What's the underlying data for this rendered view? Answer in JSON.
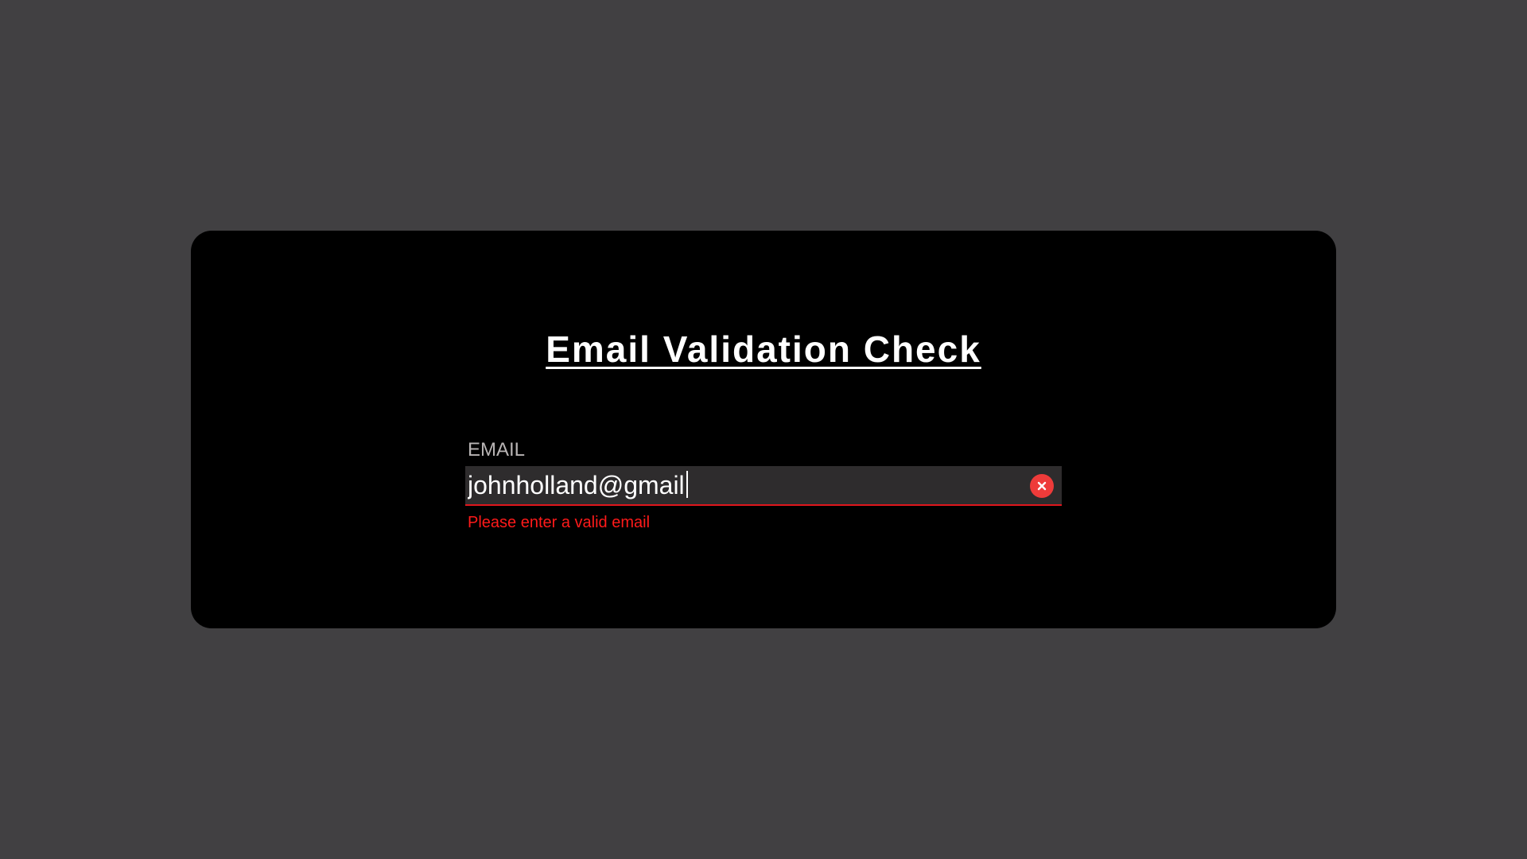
{
  "page": {
    "title": "Email Validation Check"
  },
  "email_field": {
    "label": "EMAIL",
    "value": "johnholland@gmail",
    "error_message": "Please enter a valid email",
    "clear_icon": "close-circle-icon"
  },
  "colors": {
    "page_background": "#414042",
    "card_background": "#000000",
    "input_background": "#2e2c2d",
    "error": "#ff1a1a",
    "clear_button": "#ee3b3a",
    "label": "#b8b4b4"
  }
}
